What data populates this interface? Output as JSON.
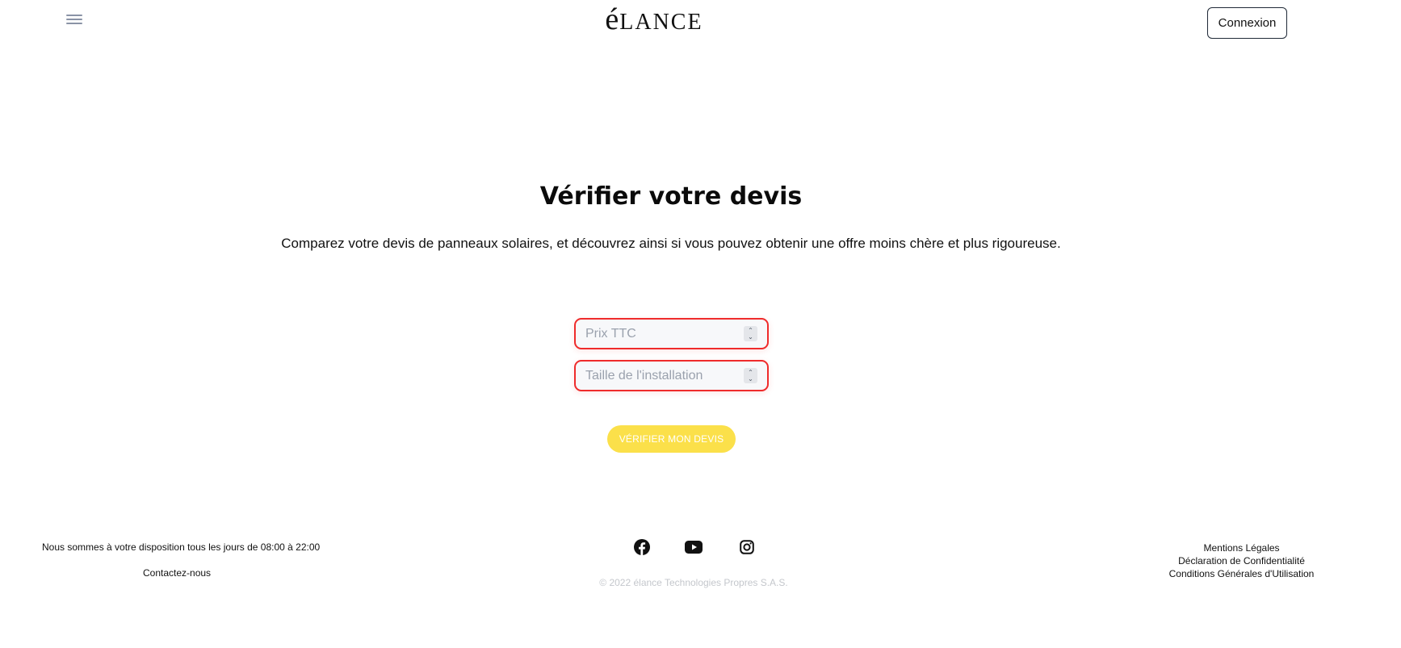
{
  "header": {
    "menu_icon": "hamburger-menu-icon",
    "logo_text": "élance",
    "login_label": "Connexion"
  },
  "main": {
    "title": "Vérifier votre devis",
    "subtitle": "Comparez votre devis de panneaux solaires, et découvrez ainsi si vous pouvez obtenir une offre moins chère et plus rigoureuse.",
    "price_placeholder": "Prix TTC",
    "price_value": "",
    "size_placeholder": "Taille de l'installation",
    "size_value": "",
    "verify_label": "VÉRIFIER MON DEVIS"
  },
  "footer": {
    "availability": "Nous sommes à votre disposition tous les jours de 08:00 à 22:00",
    "contact_label": "Contactez-nous",
    "social_icons": [
      "facebook-icon",
      "youtube-icon",
      "instagram-icon"
    ],
    "copyright": "© 2022 élance Technologies Propres S.A.S.",
    "legal_links": [
      "Mentions Légales",
      "Déclaration de Confidentialité",
      "Conditions Générales d'Utilisation"
    ]
  },
  "colors": {
    "accent_yellow": "#fbe04a",
    "error_red": "#ef2b2b",
    "muted_gray": "#c4c7cc"
  }
}
